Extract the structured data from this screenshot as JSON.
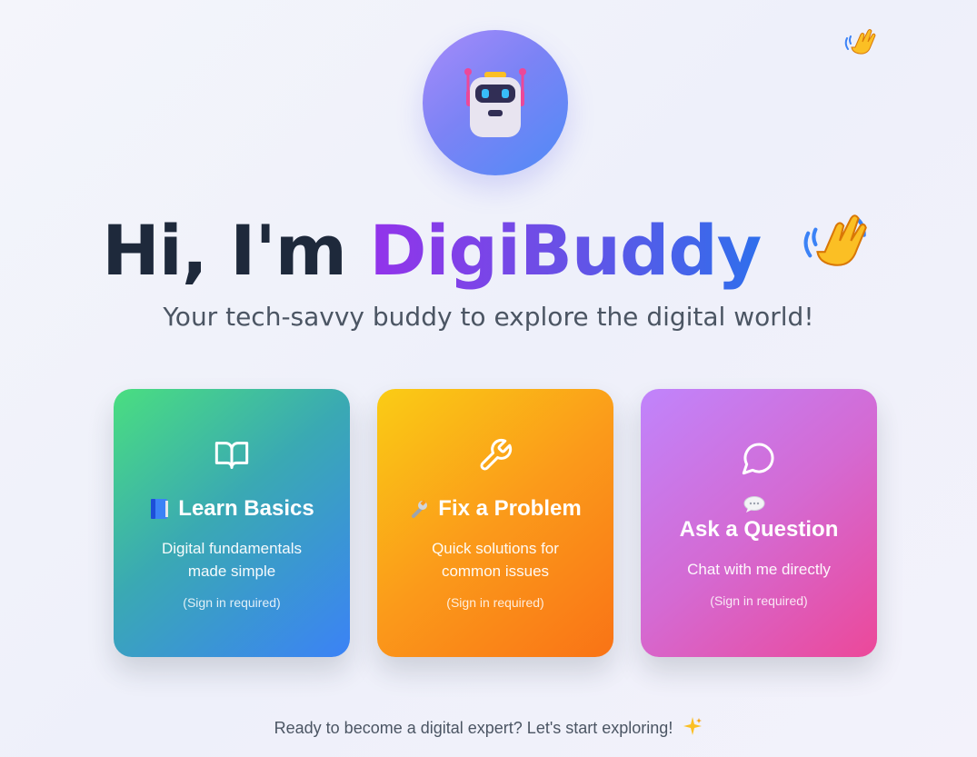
{
  "hero": {
    "greeting": "Hi, I'm ",
    "brand_name": "DigiBuddy",
    "subtitle": "Your tech-savvy buddy to explore the digital world!",
    "avatar_icon": "robot-icon",
    "wave_icon": "waving-hand-icon"
  },
  "cards": [
    {
      "icon": "book-open-icon",
      "emoji": "blue-book-icon",
      "title": "Learn Basics",
      "description": "Digital fundamentals made simple",
      "note": "(Sign in required)",
      "colors": [
        "#4ade80",
        "#3b82f6"
      ]
    },
    {
      "icon": "wrench-icon",
      "emoji": "wrench-emoji-icon",
      "title": "Fix a Problem",
      "description": "Quick solutions for common issues",
      "note": "(Sign in required)",
      "colors": [
        "#facc15",
        "#f97316"
      ]
    },
    {
      "icon": "message-circle-icon",
      "emoji": "speech-balloon-icon",
      "title": "Ask a Question",
      "description": "Chat with me directly",
      "note": "(Sign in required)",
      "colors": [
        "#c084fc",
        "#ec4899"
      ]
    }
  ],
  "footer": {
    "text": "Ready to become a digital expert? Let's start exploring!",
    "icon": "sparkles-icon"
  },
  "colors": {
    "heading": "#1e293b",
    "brand_start": "#9333ea",
    "brand_end": "#2f6fec",
    "subtitle": "#4b5563"
  }
}
